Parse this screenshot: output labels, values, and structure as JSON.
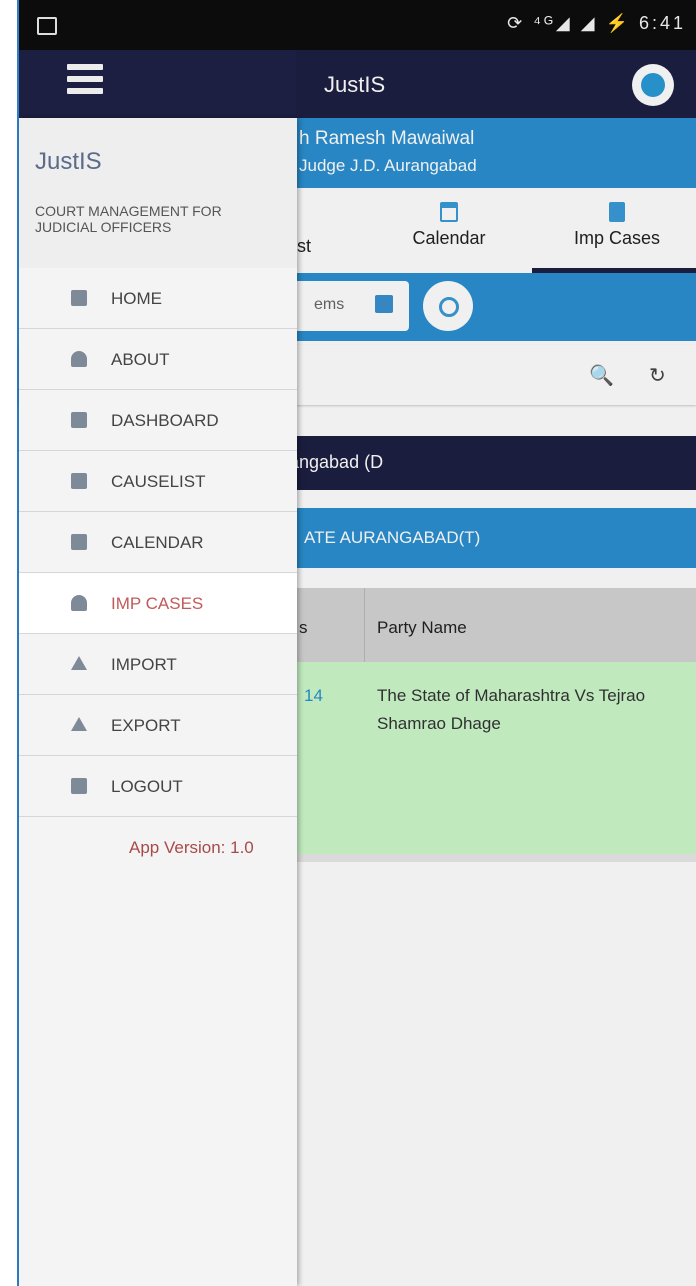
{
  "status_bar": {
    "icons_text": "⟳ ⁴ᴳ◢ ◢ ⚡ 6:41"
  },
  "app_bar": {
    "title": "JustIS"
  },
  "user_info": {
    "name": "h Ramesh Mawaiwal",
    "court": "Judge J.D. Aurangabad"
  },
  "tabs": [
    {
      "label": "st"
    },
    {
      "label": "Calendar",
      "icon": "calendar-icon"
    },
    {
      "label": "Imp Cases",
      "icon": "document-icon",
      "active": true
    }
  ],
  "filter": {
    "pill_text": "ems",
    "refresh_icon": "refresh-icon"
  },
  "search": {
    "search_icon": "🔍",
    "refresh_icon": "↻"
  },
  "court_heading": "angabad (D",
  "court_subheading": "ATE AURANGABAD(T)",
  "table": {
    "headers": [
      "s",
      "Party Name"
    ],
    "rows": [
      {
        "col1": "14",
        "party": "The State of Maharashtra Vs Tejrao Shamrao Dhage"
      }
    ]
  },
  "drawer": {
    "title": "JustIS",
    "subtitle": "COURT MANAGEMENT FOR JUDICIAL OFFICERS",
    "items": [
      {
        "label": "HOME",
        "icon": "home-icon"
      },
      {
        "label": "ABOUT",
        "icon": "about-icon"
      },
      {
        "label": "DASHBOARD",
        "icon": "dashboard-icon"
      },
      {
        "label": "CAUSELIST",
        "icon": "causelist-icon"
      },
      {
        "label": "CALENDAR",
        "icon": "calendar-icon"
      },
      {
        "label": "IMP CASES",
        "icon": "person-icon",
        "active": true
      },
      {
        "label": "IMPORT",
        "icon": "import-icon"
      },
      {
        "label": "EXPORT",
        "icon": "export-icon"
      },
      {
        "label": "LOGOUT",
        "icon": "logout-icon"
      }
    ],
    "app_version": "App Version: 1.0"
  },
  "colors": {
    "primary_dark": "#1d1f42",
    "primary_blue": "#2a8fd0",
    "row_green": "#ccf9ca",
    "active_text": "#c05a5a"
  }
}
